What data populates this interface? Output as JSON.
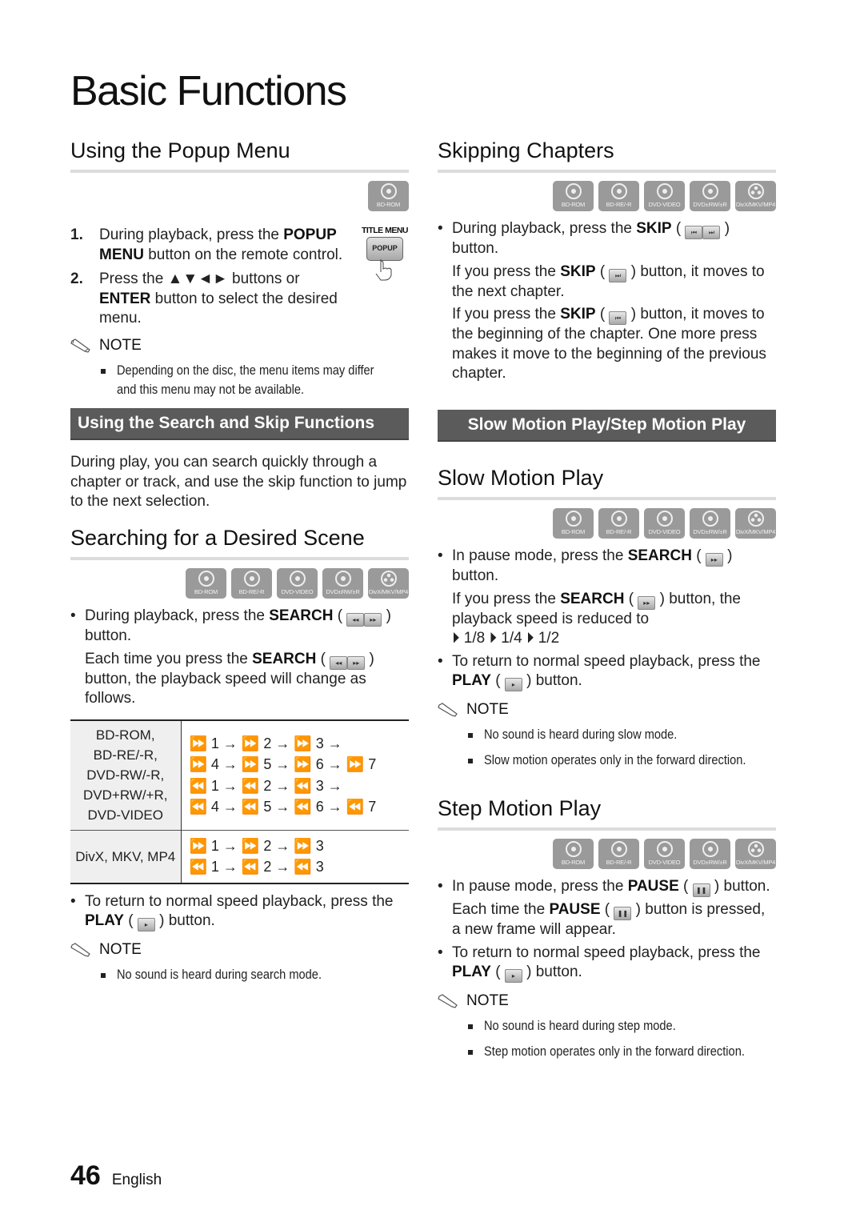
{
  "page_title": "Basic Functions",
  "disc_labels": [
    "BD-ROM",
    "BD-RE/-R",
    "DVD-VIDEO",
    "DVD±RW/±R",
    "DivX/MKV/MP4"
  ],
  "popup": {
    "title": "Using the Popup Menu",
    "disc": "BD-ROM",
    "remote_caption": "TITLE MENU",
    "remote_key": "POPUP",
    "steps": [
      {
        "num": "1.",
        "pre": "During playback, press the ",
        "bold": "POPUP MENU",
        "post": " button on the remote control."
      },
      {
        "num": "2.",
        "pre": "Press the ▲▼◄► buttons or ",
        "bold": "ENTER",
        "post": " button to select the desired menu."
      }
    ],
    "note_label": "NOTE",
    "notes": [
      "Depending on the disc, the menu items may differ",
      "and this menu may not be available."
    ]
  },
  "search_skip": {
    "band": "Using the Search and Skip Functions",
    "intro": "During play, you can search quickly through a chapter or track, and use the skip function to jump to the next selection."
  },
  "searching": {
    "title": "Searching for a Desired Scene",
    "bullet1_pre": "During playback, press the ",
    "bullet1_bold": "SEARCH",
    "bullet1_post": " button.",
    "cont_pre": "Each time you press the ",
    "cont_bold": "SEARCH",
    "cont_post": " button, the playback speed will change as follows.",
    "table": [
      {
        "devices": [
          "BD-ROM,",
          "BD-RE/-R,",
          "DVD-RW/-R,",
          "DVD+RW/+R,",
          "DVD-VIDEO"
        ],
        "sequences": [
          "⏩ 1 → ⏩ 2 → ⏩ 3 →",
          "⏩ 4 → ⏩ 5 → ⏩ 6 → ⏩ 7",
          "⏪ 1 → ⏪ 2 → ⏪ 3 →",
          "⏪ 4 → ⏪ 5 → ⏪ 6 → ⏪ 7"
        ]
      },
      {
        "devices": [
          "DivX, MKV, MP4"
        ],
        "sequences": [
          "⏩ 1 → ⏩ 2 → ⏩ 3",
          "⏪ 1 → ⏪ 2 → ⏪ 3"
        ]
      }
    ],
    "return_pre": "To return to normal speed playback, press the ",
    "return_bold": "PLAY",
    "return_post": " button.",
    "note_label": "NOTE",
    "notes": [
      "No sound is heard during search mode."
    ]
  },
  "skipping": {
    "title": "Skipping Chapters",
    "b1_pre": "During playback, press the ",
    "b1_bold": "SKIP",
    "b1_post": " button.",
    "c1_pre": "If you press the ",
    "c1_bold": "SKIP",
    "c1_post": " button, it moves to the next chapter.",
    "c2_pre": "If you press the ",
    "c2_bold": "SKIP",
    "c2_post": " button, it moves to the beginning of the chapter. One more press makes it move to the beginning of the previous chapter."
  },
  "slow_step": {
    "band": "Slow Motion Play/Step Motion Play"
  },
  "slow": {
    "title": "Slow Motion Play",
    "b1_pre": "In pause mode, press the ",
    "b1_bold": "SEARCH",
    "b1_post": " button.",
    "c1_pre": "If you press the ",
    "c1_bold": "SEARCH",
    "c1_post": " button, the playback speed is reduced to",
    "speeds": "⏵ 1/8 ⏵ 1/4 ⏵ 1/2",
    "return_pre": "To return to normal speed playback, press the ",
    "return_bold": "PLAY",
    "return_post": " button.",
    "note_label": "NOTE",
    "notes": [
      "No sound is heard during slow mode.",
      "Slow motion operates only in the forward direction."
    ]
  },
  "step": {
    "title": "Step Motion Play",
    "b1_pre": "In pause mode, press the ",
    "b1_bold": "PAUSE",
    "b1_post": " button.",
    "c1_pre": "Each time the ",
    "c1_bold": "PAUSE",
    "c1_post": " button is pressed, a new frame will appear.",
    "return_pre": "To return to normal speed playback, press the ",
    "return_bold": "PLAY",
    "return_post": " button.",
    "note_label": "NOTE",
    "notes": [
      "No sound is heard during step mode.",
      "Step motion operates only in the forward direction."
    ]
  },
  "footer": {
    "page": "46",
    "language": "English"
  }
}
